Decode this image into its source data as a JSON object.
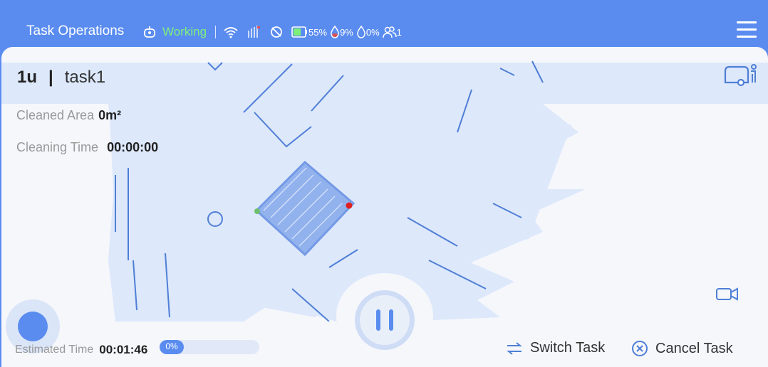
{
  "header": {
    "title": "Task Operations",
    "status": "Working",
    "battery": "55%",
    "water_clean": "9%",
    "water_dirty": "0%",
    "users": "1"
  },
  "task": {
    "floor": "1u",
    "separator": "|",
    "name": "task1",
    "cleaned_area_label": "Cleaned Area",
    "cleaned_area_value": "0m²",
    "cleaning_time_label": "Cleaning Time",
    "cleaning_time_value": "00:00:00"
  },
  "footer": {
    "estimated_label": "Estimated Time",
    "estimated_value": "00:01:46",
    "progress_text": "0%",
    "progress_value": 0,
    "switch_task": "Switch Task",
    "cancel_task": "Cancel Task"
  },
  "colors": {
    "accent": "#5a8cf0",
    "working": "#7ef07a",
    "map_fill": "#dde8fb",
    "start_dot": "#6dbf6d",
    "end_dot": "#e02020"
  },
  "icons": [
    "robot-icon",
    "wifi-icon",
    "signal-icon",
    "no-disturb-icon",
    "battery-icon",
    "clean-water-icon",
    "dirty-water-icon",
    "users-icon",
    "menu-icon",
    "vehicle-icon",
    "camera-icon",
    "switch-icon",
    "cancel-icon"
  ]
}
